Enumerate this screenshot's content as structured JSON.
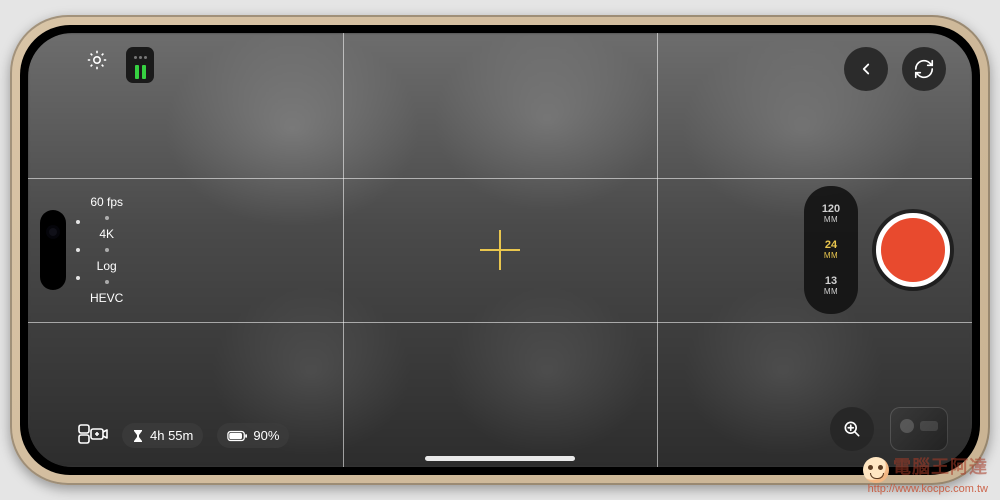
{
  "watermark": {
    "title": "電腦王阿達",
    "url": "http://www.kocpc.com.tw"
  },
  "settings": {
    "fps": "60 fps",
    "resolution": "4K",
    "profile": "Log",
    "codec": "HEVC"
  },
  "lenses": {
    "options": [
      {
        "value": "120",
        "unit": "MM"
      },
      {
        "value": "24",
        "unit": "MM"
      },
      {
        "value": "13",
        "unit": "MM"
      }
    ],
    "active_index": 1
  },
  "status": {
    "time_remaining": "4h 55m",
    "battery_pct": "90%"
  },
  "icons": {
    "settings": "gear-icon",
    "histogram": "levels-icon",
    "back": "chevron-left-icon",
    "flip": "flip-camera-icon",
    "zoom": "magnify-plus-icon",
    "mode": "multicam-icon",
    "timer": "hourglass-icon",
    "battery": "battery-icon"
  }
}
